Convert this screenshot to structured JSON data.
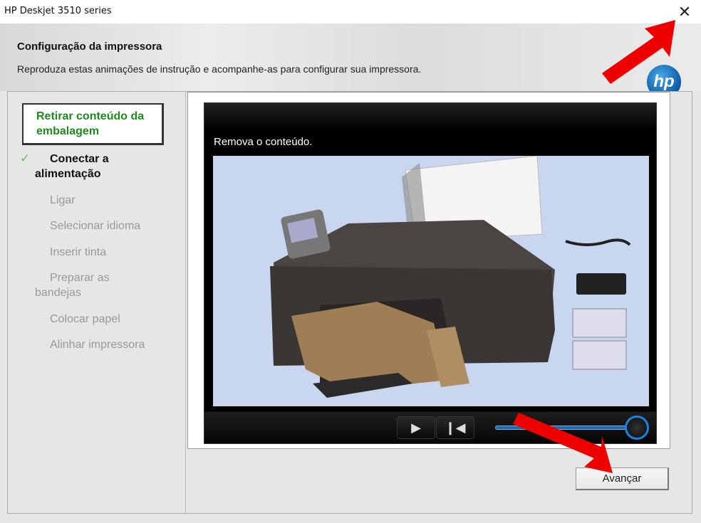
{
  "window": {
    "title": "HP Deskjet 3510 series",
    "close_icon": "close-icon"
  },
  "header": {
    "title": "Configuração da impressora",
    "subtitle": "Reproduza estas animações de instrução e acompanhe-as para configurar sua impressora.",
    "logo": "hp"
  },
  "nav": {
    "items": [
      {
        "label": "Retirar conteúdo da embalagem",
        "state": "current"
      },
      {
        "label": "Conectar a alimentação",
        "state": "done"
      },
      {
        "label": "Ligar",
        "state": "pending"
      },
      {
        "label": "Selecionar idioma",
        "state": "pending"
      },
      {
        "label": "Inserir tinta",
        "state": "pending"
      },
      {
        "label": "Preparar as bandejas",
        "state": "pending"
      },
      {
        "label": "Colocar papel",
        "state": "pending"
      },
      {
        "label": "Alinhar impressora",
        "state": "pending"
      }
    ]
  },
  "video": {
    "caption": "Remova o conteúdo.",
    "play_icon": "▶",
    "restart_icon": "❙◀",
    "progress_percent": 100
  },
  "buttons": {
    "next": "Avançar"
  },
  "colors": {
    "current_step": "#1c8a1c",
    "slider": "#1a82e0",
    "annotation_arrow": "#ee0000"
  }
}
